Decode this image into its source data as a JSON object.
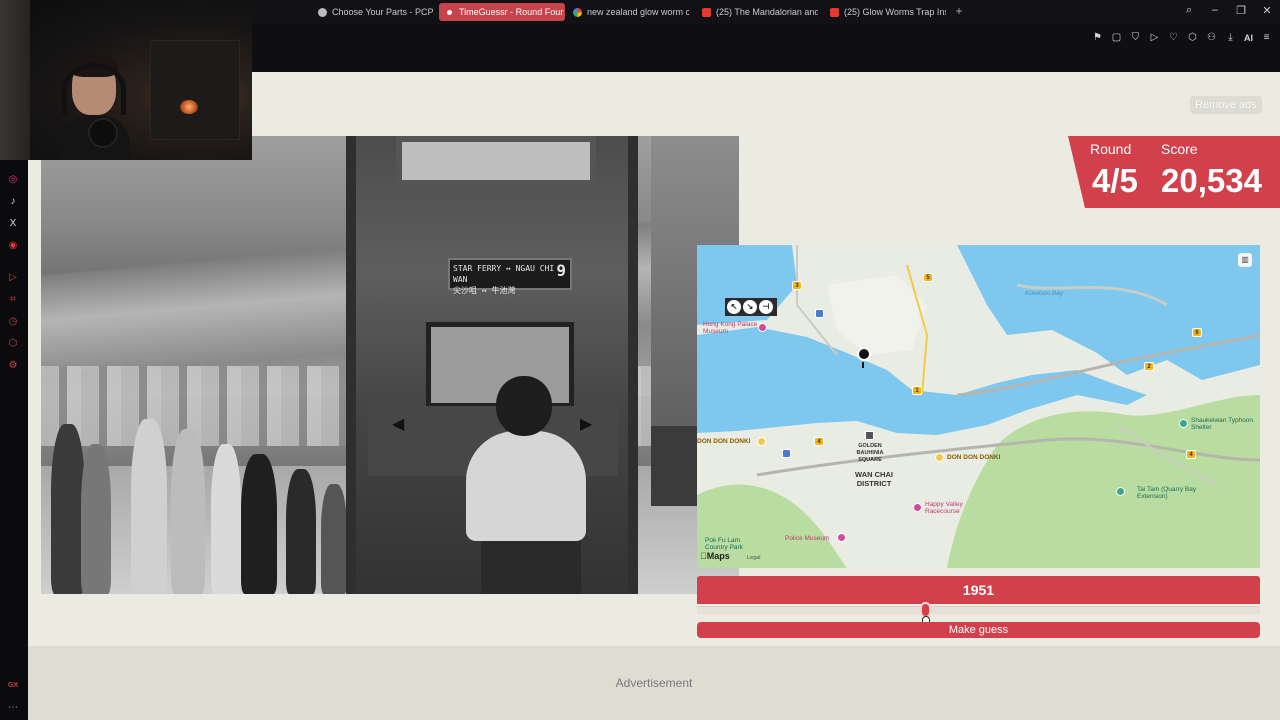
{
  "browser": {
    "tabs": [
      {
        "label": "Choose Your Parts - PCPa",
        "icon": "pcpartpicker-icon",
        "active": false
      },
      {
        "label": "TimeGuessr - Round Four",
        "icon": "timeguessr-icon",
        "active": true
      },
      {
        "label": "new zealand glow worm c",
        "icon": "google-icon",
        "active": false
      },
      {
        "label": "(25) The Mandalorian and",
        "icon": "youtube-icon",
        "active": false
      },
      {
        "label": "(25) Glow Worms Trap Ins",
        "icon": "youtube-icon",
        "active": false
      }
    ],
    "new_tab": "+",
    "toolbar_ai_label": "AI",
    "sidebar_bottom_label": "GX"
  },
  "game": {
    "remove_ads": "Remove ads",
    "round_label": "Round",
    "round_value": "4/5",
    "score_label": "Score",
    "score_value": "20,534",
    "bus_sign_line1": "STAR FERRY ↔ NGAU CHI WAN",
    "bus_sign_line2": "尖沙咀 ↔ 牛池灣",
    "bus_sign_number": "9",
    "year_value": "1951",
    "slider_fraction": 0.405,
    "make_guess": "Make guess",
    "advertisement": "Advertisement",
    "accent_color": "#d2404b"
  },
  "map": {
    "labels": {
      "kowloon_bay": "Kowloon Bay",
      "hk_palace_museum": "Hong Kong Palace Museum",
      "shau_kei_wan": "Shaukeiwan Typhoon Shelter",
      "don_don_donki_1": "DON DON DONKI",
      "don_don_donki_2": "DON DON DONKI",
      "golden_bauhinia": "GOLDEN BAUHINIA SQUARE",
      "wan_chai": "WAN CHAI DISTRICT",
      "happy_valley": "Happy Valley Racecourse",
      "tai_tam": "Tai Tam (Quarry Bay Extension)",
      "pok_fu_lam": "Pok Fu Lam Country Park",
      "police_museum": "Police Museum"
    },
    "shields": [
      "3",
      "5",
      "1",
      "2",
      "6",
      "4",
      "4"
    ],
    "brand": "Maps",
    "legal": "Legal",
    "water_color": "#7ec8f0",
    "park_color": "#b9dca0"
  }
}
